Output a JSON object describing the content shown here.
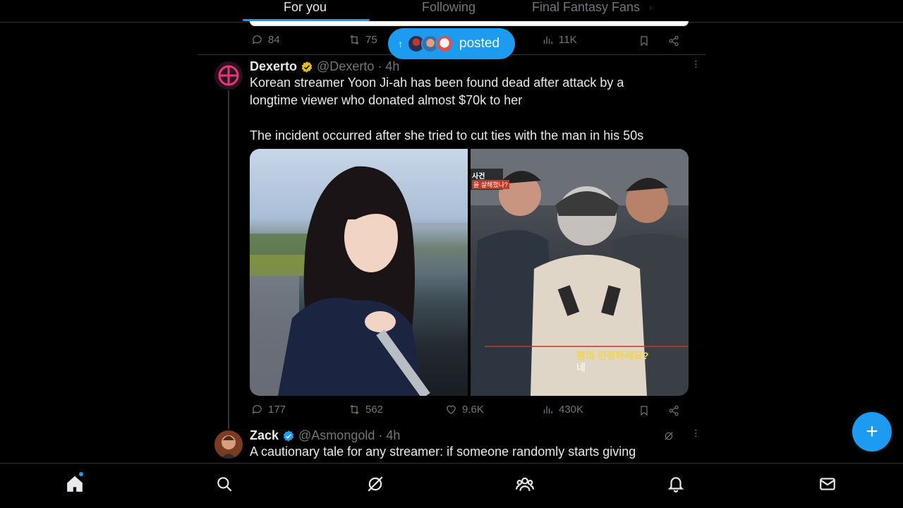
{
  "tabs": {
    "items": [
      {
        "label": "For you",
        "active": true
      },
      {
        "label": "Following",
        "active": false
      },
      {
        "label": "Final Fantasy Fans",
        "active": false
      }
    ]
  },
  "prev_tweet": {
    "replies": "84",
    "reposts": "75",
    "views": "11K"
  },
  "posted_pill": {
    "label": "posted"
  },
  "tweet": {
    "author": "Dexerto",
    "handle": "@Dexerto · 4h",
    "verified_badge": "gold",
    "text_line1": "Korean streamer Yoon Ji-ah has been found dead after attack by a",
    "text_line2": "longtime viewer who donated almost $70k to her",
    "text_line3": "The incident occurred after she tried to cut ties with the man in his 50s",
    "media_overlay_tag": "사건",
    "media_overlay_sub": "을 살해했나?",
    "media_caption_1": "혐의 인정하세요?",
    "media_caption_2": "네",
    "replies": "177",
    "reposts": "562",
    "likes": "9.6K",
    "views": "430K"
  },
  "next_tweet": {
    "author": "Zack",
    "handle": "@Asmongold · 4h",
    "verified_badge": "blue",
    "text_line1": "A cautionary tale for any streamer: if someone randomly starts giving"
  },
  "colors": {
    "accent": "#1d9bf0",
    "gold_badge": "#e8b923",
    "text": "#e7e9ea",
    "muted": "#71767b",
    "border": "#2f3336"
  },
  "bottom_nav": [
    "home-icon",
    "search-icon",
    "grok-icon",
    "communities-icon",
    "notifications-icon",
    "messages-icon"
  ]
}
